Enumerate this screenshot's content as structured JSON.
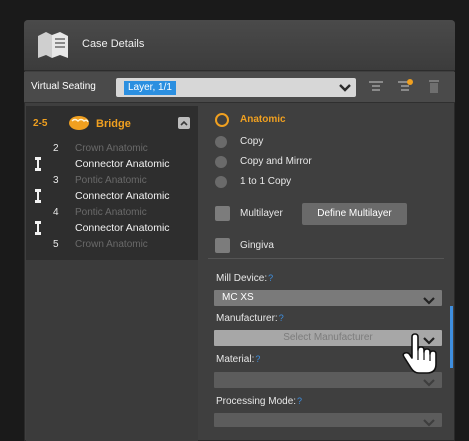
{
  "window": {
    "title": "Case Details"
  },
  "seating": {
    "label": "Virtual Seating",
    "value": "Layer, 1/1"
  },
  "tree": {
    "bridge_range": "2-5",
    "bridge_label": "Bridge",
    "items": [
      {
        "num": "2",
        "label": "Crown Anatomic"
      },
      {
        "num": "",
        "label": "Connector Anatomic"
      },
      {
        "num": "3",
        "label": "Pontic Anatomic"
      },
      {
        "num": "",
        "label": "Connector Anatomic"
      },
      {
        "num": "4",
        "label": "Pontic Anatomic"
      },
      {
        "num": "",
        "label": "Connector Anatomic"
      },
      {
        "num": "5",
        "label": "Crown Anatomic"
      }
    ]
  },
  "type_options": {
    "anatomic": "Anatomic",
    "copy": "Copy",
    "copy_mirror": "Copy and Mirror",
    "one_to_one": "1 to 1 Copy"
  },
  "multilayer": {
    "label": "Multilayer",
    "define_button": "Define Multilayer"
  },
  "gingiva": {
    "label": "Gingiva"
  },
  "fields": {
    "mill_device_label": "Mill Device:",
    "mill_device_value": "MC XS",
    "manufacturer_label": "Manufacturer:",
    "manufacturer_placeholder": "Select Manufacturer",
    "material_label": "Material:",
    "processing_label": "Processing Mode:"
  },
  "colors": {
    "accent_orange": "#f0a020",
    "accent_blue": "#2b8fe0",
    "panel_dark": "#2e2e2e",
    "window_bg": "#3f3f3f"
  }
}
